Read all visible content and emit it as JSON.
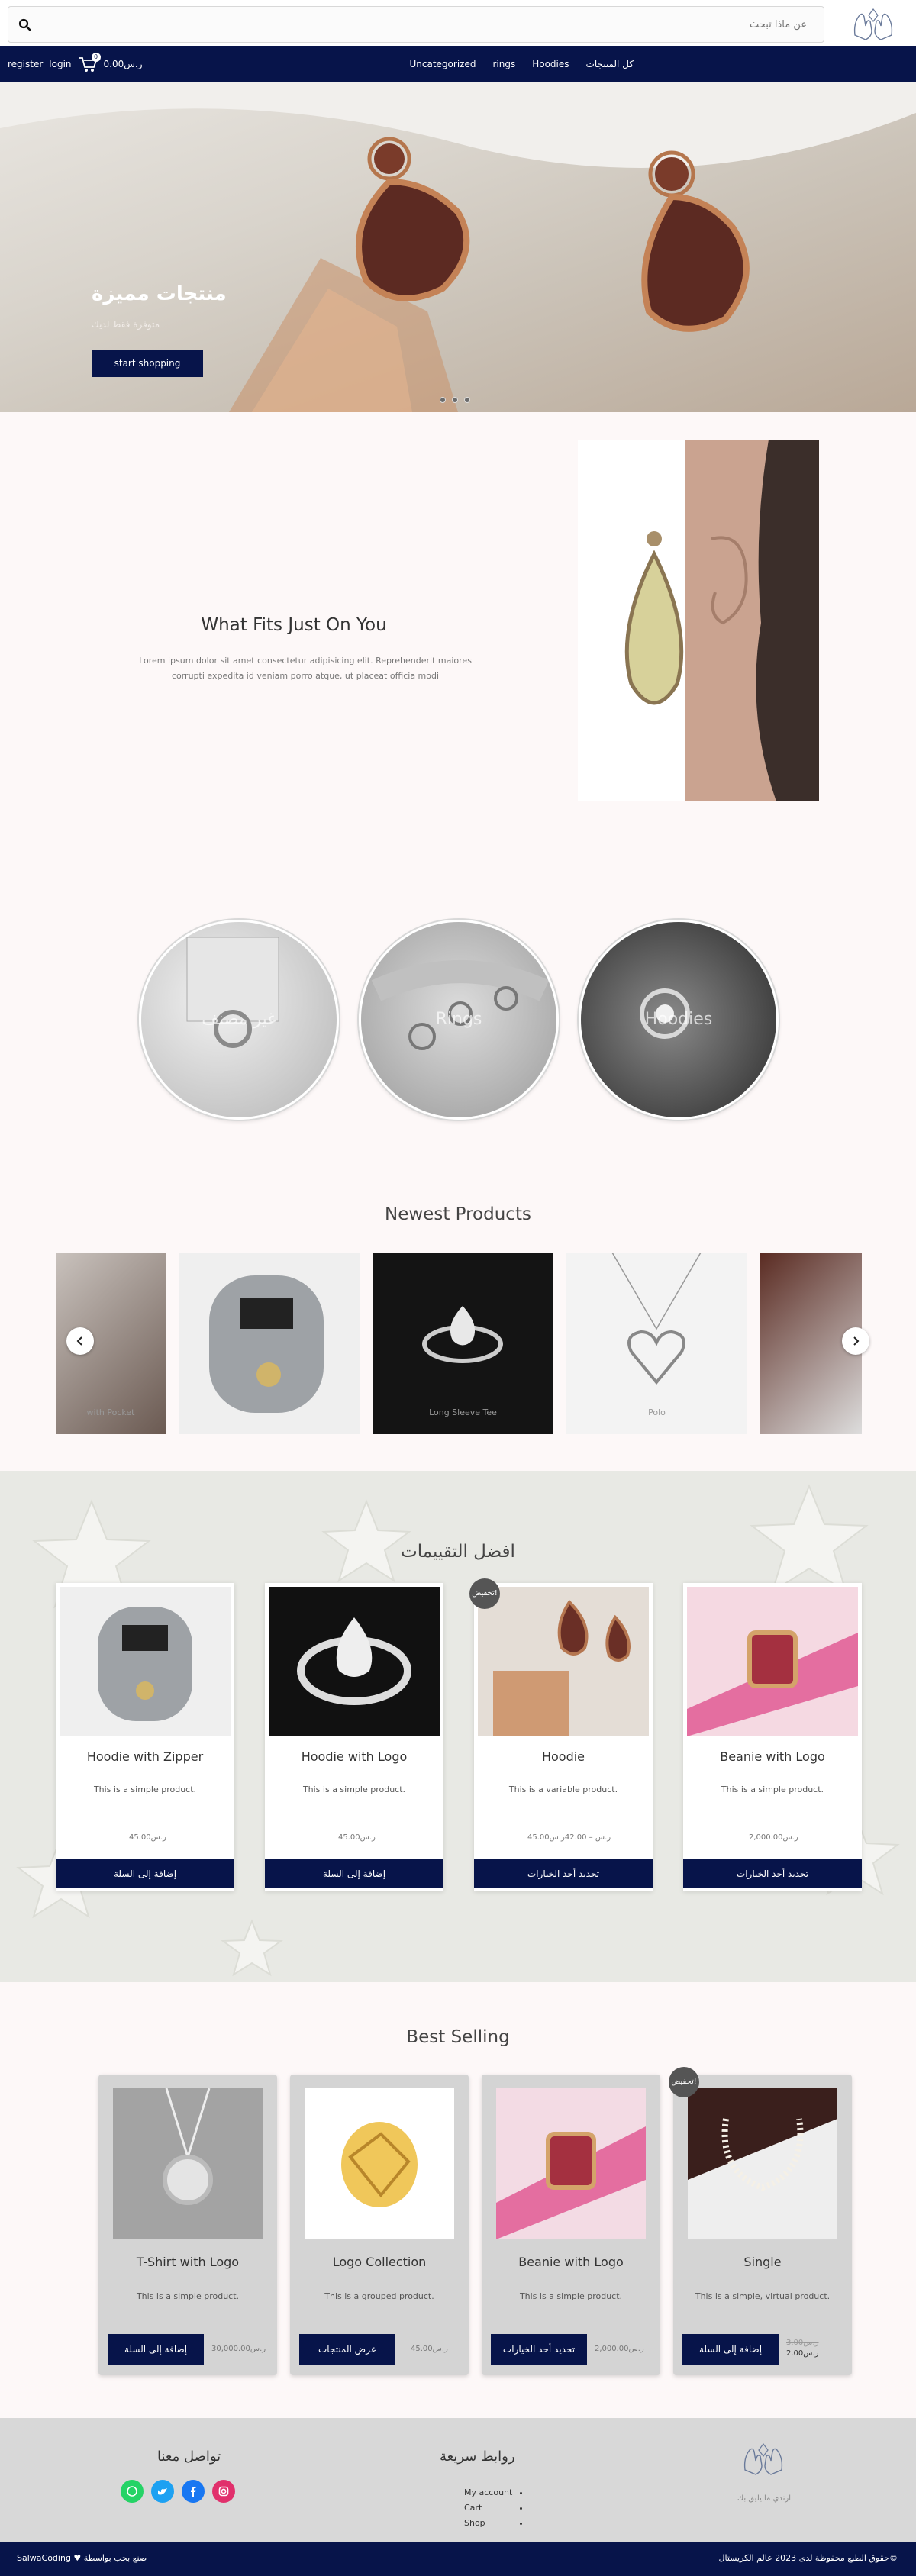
{
  "header": {
    "search_placeholder": "عن ماذا تبحث",
    "logo_name": "hands-logo"
  },
  "nav": {
    "register": "register",
    "login": "login",
    "cart_count": "0",
    "cart_total": "0.00ر.س",
    "menu": [
      "كل المنتجات",
      "Hoodies",
      "rings",
      "Uncategorized"
    ]
  },
  "hero": {
    "title": "منتجات مميزة",
    "subtitle": "متوفرة فقط لديك",
    "button": "start shopping"
  },
  "fits": {
    "title": "What Fits Just On You",
    "text": "Lorem ipsum dolor sit amet consectetur adipisicing elit. Reprehenderit maiores corrupti expedita id veniam porro atque, ut placeat officia modi"
  },
  "categories": [
    "غير مصنف",
    "Rings",
    "Hoodies"
  ],
  "newest": {
    "title": "Newest Products",
    "items": [
      "with Pocket",
      "",
      "Long Sleeve Tee",
      "Polo",
      ""
    ]
  },
  "top_rated": {
    "title": "افضل التقييمات",
    "products": [
      {
        "title": "Hoodie with Zipper",
        "desc": "This is a simple product.",
        "price": "45.00ر.س",
        "button": "إضافة إلى السلة",
        "sale": ""
      },
      {
        "title": "Hoodie with Logo",
        "desc": "This is a simple product.",
        "price": "45.00ر.س",
        "button": "إضافة إلى السلة",
        "sale": ""
      },
      {
        "title": "Hoodie",
        "desc": "This is a variable product.",
        "price": "45.00ر.س – 42.00ر.س",
        "button": "تحديد أحد الخيارات",
        "sale": "تخفيض!"
      },
      {
        "title": "Beanie with Logo",
        "desc": "This is a simple product.",
        "price": "2,000.00ر.س",
        "button": "تحديد أحد الخيارات",
        "sale": ""
      }
    ]
  },
  "best_selling": {
    "title": "Best Selling",
    "products": [
      {
        "title": "T-Shirt with Logo",
        "desc": "This is a simple product.",
        "price": "30,000.00ر.س",
        "old_price": "",
        "button": "إضافة إلى السلة",
        "sale": ""
      },
      {
        "title": "Logo Collection",
        "desc": "This is a grouped product.",
        "price": "45.00ر.س",
        "old_price": "",
        "button": "عرض المنتجات",
        "sale": ""
      },
      {
        "title": "Beanie with Logo",
        "desc": "This is a simple product.",
        "price": "2,000.00ر.س",
        "old_price": "",
        "button": "تحديد أحد الخيارات",
        "sale": ""
      },
      {
        "title": "Single",
        "desc": "This is a simple, virtual product.",
        "price": "2.00ر.س",
        "old_price": "3.00ر.س",
        "button": "إضافة إلى السلة",
        "sale": "تخفيض!"
      }
    ]
  },
  "footer": {
    "contact_title": "تواصل معنا",
    "links_title": "روابط سريعة",
    "links": [
      "My account",
      "Cart",
      "Shop"
    ],
    "tagline": "ارتدي ما يليق بك",
    "made_by": "صنع بحب بواسطة ♥ SalwaCoding",
    "copyright": "©حقوق الطبع محفوظة لدى 2023 عالم الكريستال"
  },
  "colors": {
    "navy": "#07144a",
    "whatsapp": "#25d366",
    "twitter": "#1da1f2",
    "facebook": "#1877f2",
    "instagram": "#e1306c"
  }
}
